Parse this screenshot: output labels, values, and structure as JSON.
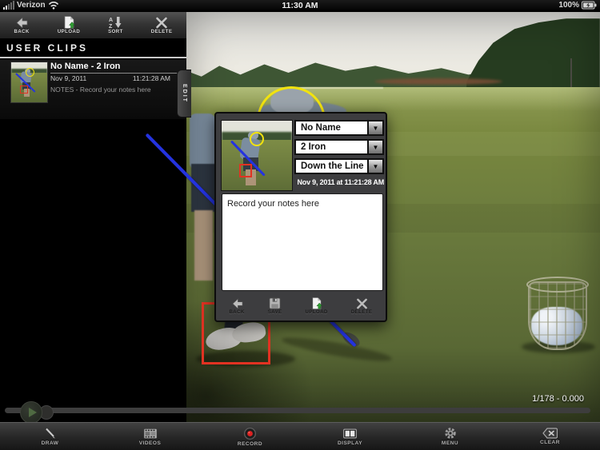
{
  "status_bar": {
    "carrier": "Verizon",
    "time": "11:30 AM",
    "battery_percent": "100%"
  },
  "sidebar": {
    "toolbar": {
      "back_label": "BACK",
      "upload_label": "UPLOAD",
      "sort_label": "SORT",
      "delete_label": "DELETE"
    },
    "header": "USER CLIPS",
    "clip": {
      "title": "No Name - 2 Iron",
      "date": "Nov 9, 2011",
      "time": "11:21:28 AM",
      "notes_preview": "NOTES - Record your notes here",
      "edit_label": "EDIT"
    }
  },
  "popup": {
    "name_value": "No Name",
    "club_value": "2 Iron",
    "view_value": "Down the Line",
    "dropdown_arrow": "▼",
    "timestamp": "Nov 9, 2011 at 11:21:28 AM",
    "notes_text": "Record your notes here",
    "back_label": "BACK",
    "save_label": "SAVE",
    "upload_label": "UPLOAD",
    "delete_label": "DELETE"
  },
  "video": {
    "frame_counter": "1/178 - 0.000"
  },
  "bottom_toolbar": {
    "draw_label": "DRAW",
    "videos_label": "VIDEOS",
    "record_label": "RECORD",
    "display_label": "DISPLAY",
    "menu_label": "MENU",
    "clear_label": "CLEAR"
  },
  "colors": {
    "annotation_yellow": "#f2e30e",
    "annotation_blue": "#2433e0",
    "annotation_red": "#e23222",
    "record_red": "#dd2222"
  }
}
